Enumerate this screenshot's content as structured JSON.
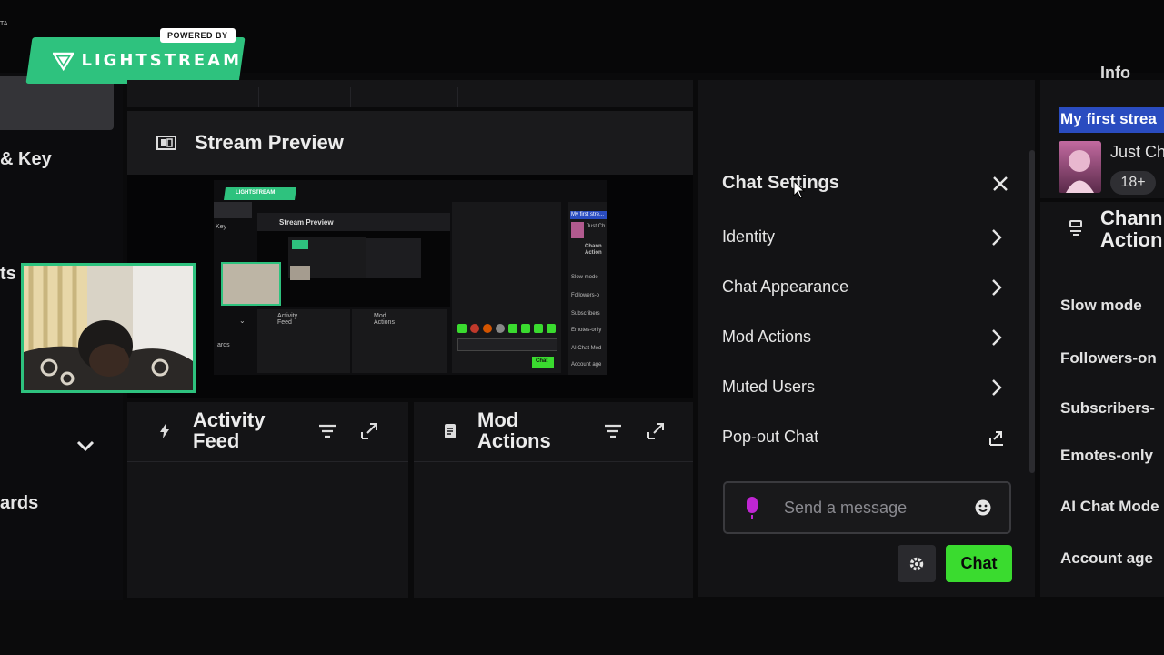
{
  "top_edge_text": "TA",
  "brand": {
    "powered_by": "POWERED BY",
    "name": "LIGHTSTREAM"
  },
  "sidebar": {
    "items": [
      {
        "label": "& Key"
      },
      {
        "label": "ts"
      },
      {
        "label": "ards"
      }
    ]
  },
  "preview": {
    "title": "Stream Preview"
  },
  "thumbnail": {
    "brand": "LIGHTSTREAM",
    "key_label": "Key",
    "preview_title": "Stream Preview",
    "activity_feed": "Activity\nFeed",
    "mod_actions": "Mod\nActions",
    "stream_title": "My first stre...",
    "category": "Just Ch",
    "channel_actions": "Chann\nAction",
    "rows": [
      "Slow mode",
      "Followers-o",
      "Subscribers",
      "Emotes-only",
      "AI Chat Mod",
      "Account age"
    ],
    "chat_button": "Chat",
    "side_text": "ards"
  },
  "activity_feed": {
    "title": "Activity\nFeed"
  },
  "mod_actions": {
    "title": "Mod\nActions"
  },
  "chat_settings": {
    "title": "Chat Settings",
    "menu": [
      {
        "label": "Identity"
      },
      {
        "label": "Chat Appearance"
      },
      {
        "label": "Mod Actions"
      },
      {
        "label": "Muted Users"
      },
      {
        "label": "Pop-out Chat"
      }
    ],
    "message_placeholder": "Send a message",
    "chat_button": "Chat"
  },
  "right_panel": {
    "info_title": "Info",
    "stream_title": "My first strea",
    "category": "Just Ch",
    "age_badge": "18+",
    "channel_actions_title": "Chann\nAction",
    "rows": [
      "Slow mode",
      "Followers-on",
      "Subscribers-",
      "Emotes-only",
      "AI Chat Mode",
      "Account age"
    ]
  },
  "colors": {
    "accent": "#2ec27e",
    "chat_button": "#3adb2f",
    "title_highlight": "#2a4cc0",
    "mic": "#c026d3"
  }
}
